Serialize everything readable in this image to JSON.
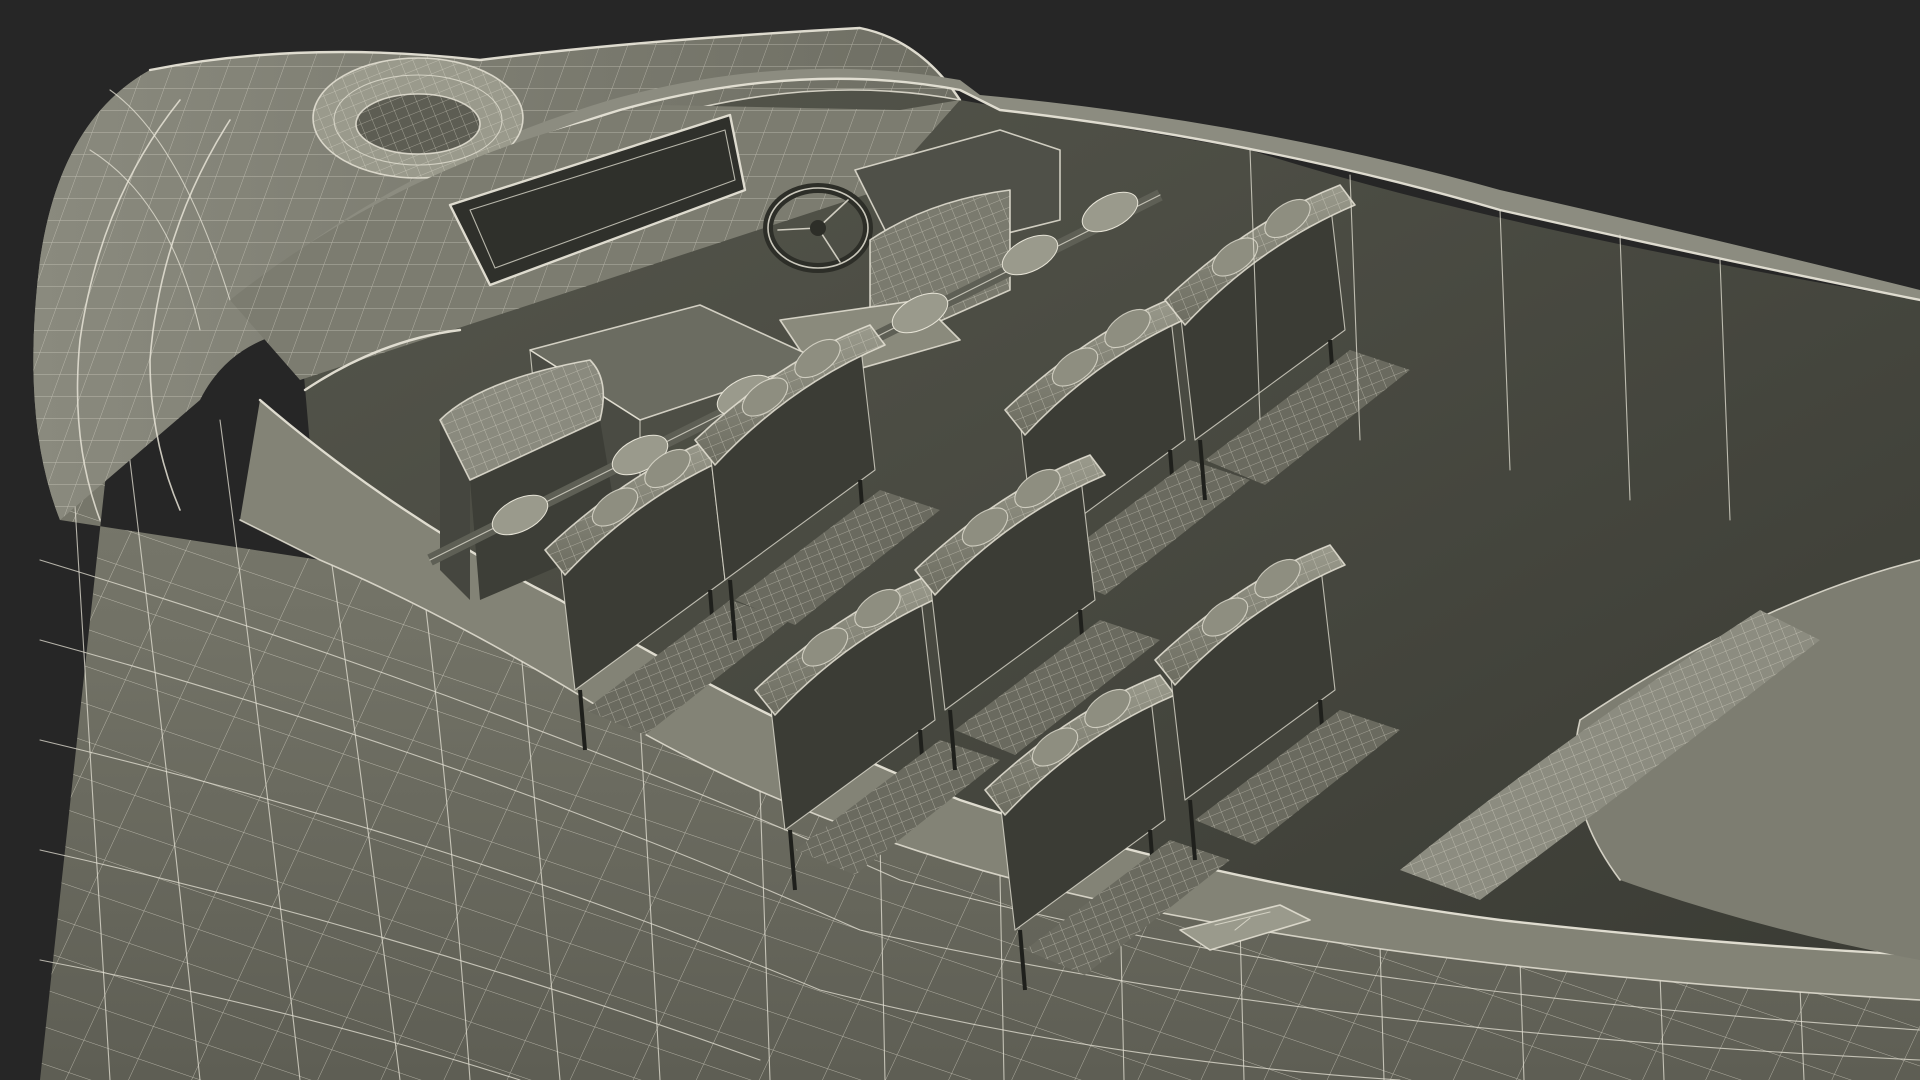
{
  "scene": {
    "subject": "boat-wireframe-render",
    "colors": {
      "background": "#262626",
      "hull_outer": "#7a7a6c",
      "hull_shadow": "#55554b",
      "deck_dark": "#3e3f38",
      "cabin_floor": "#4a4b43",
      "seat_back": "#3b3c35",
      "seat_cushion": "#8e8e80",
      "wire": "#e6e3d6"
    },
    "seat_rows": 4,
    "seats_per_row": 2
  }
}
